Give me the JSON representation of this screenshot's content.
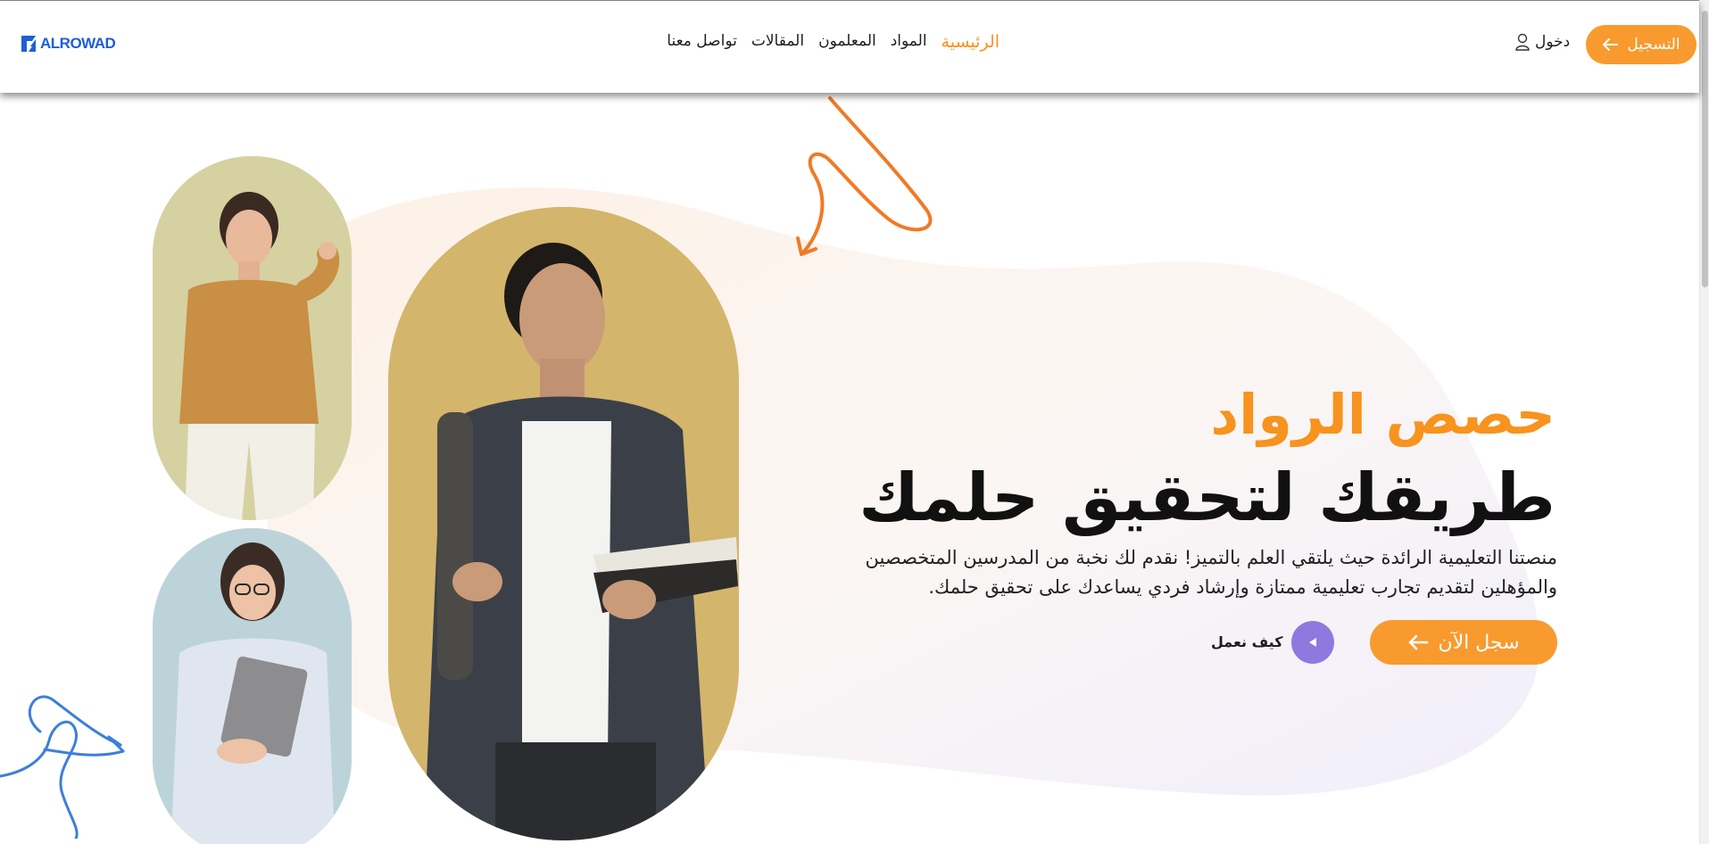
{
  "header": {
    "logo_text": "ALROWAD",
    "nav": [
      {
        "label": "الرئيسية",
        "active": true
      },
      {
        "label": "المواد",
        "active": false
      },
      {
        "label": "المعلمون",
        "active": false
      },
      {
        "label": "المقالات",
        "active": false
      },
      {
        "label": "تواصل معنا",
        "active": false
      }
    ],
    "login_label": "دخول",
    "register_label": "التسجيل"
  },
  "hero": {
    "title_line1": "حصص الرواد",
    "title_line2": "طريقك لتحقيق حلمك",
    "description": "منصتنا التعليمية الرائدة حيث يلتقي العلم بالتميز! نقدم لك نخبة من المدرسين المتخصصين والمؤهلين لتقديم تجارب تعليمية ممتازة وإرشاد فردي يساعدك على تحقيق حلمك.",
    "cta_label": "سجل الآن",
    "how_label": "كيف نعمل"
  },
  "colors": {
    "accent": "#f7931e",
    "button": "#f99a2e",
    "brand": "#1d5fd6",
    "play": "#8f79de"
  },
  "icons": [
    "logo-mark-icon",
    "user-icon",
    "arrow-left-icon",
    "play-icon"
  ]
}
